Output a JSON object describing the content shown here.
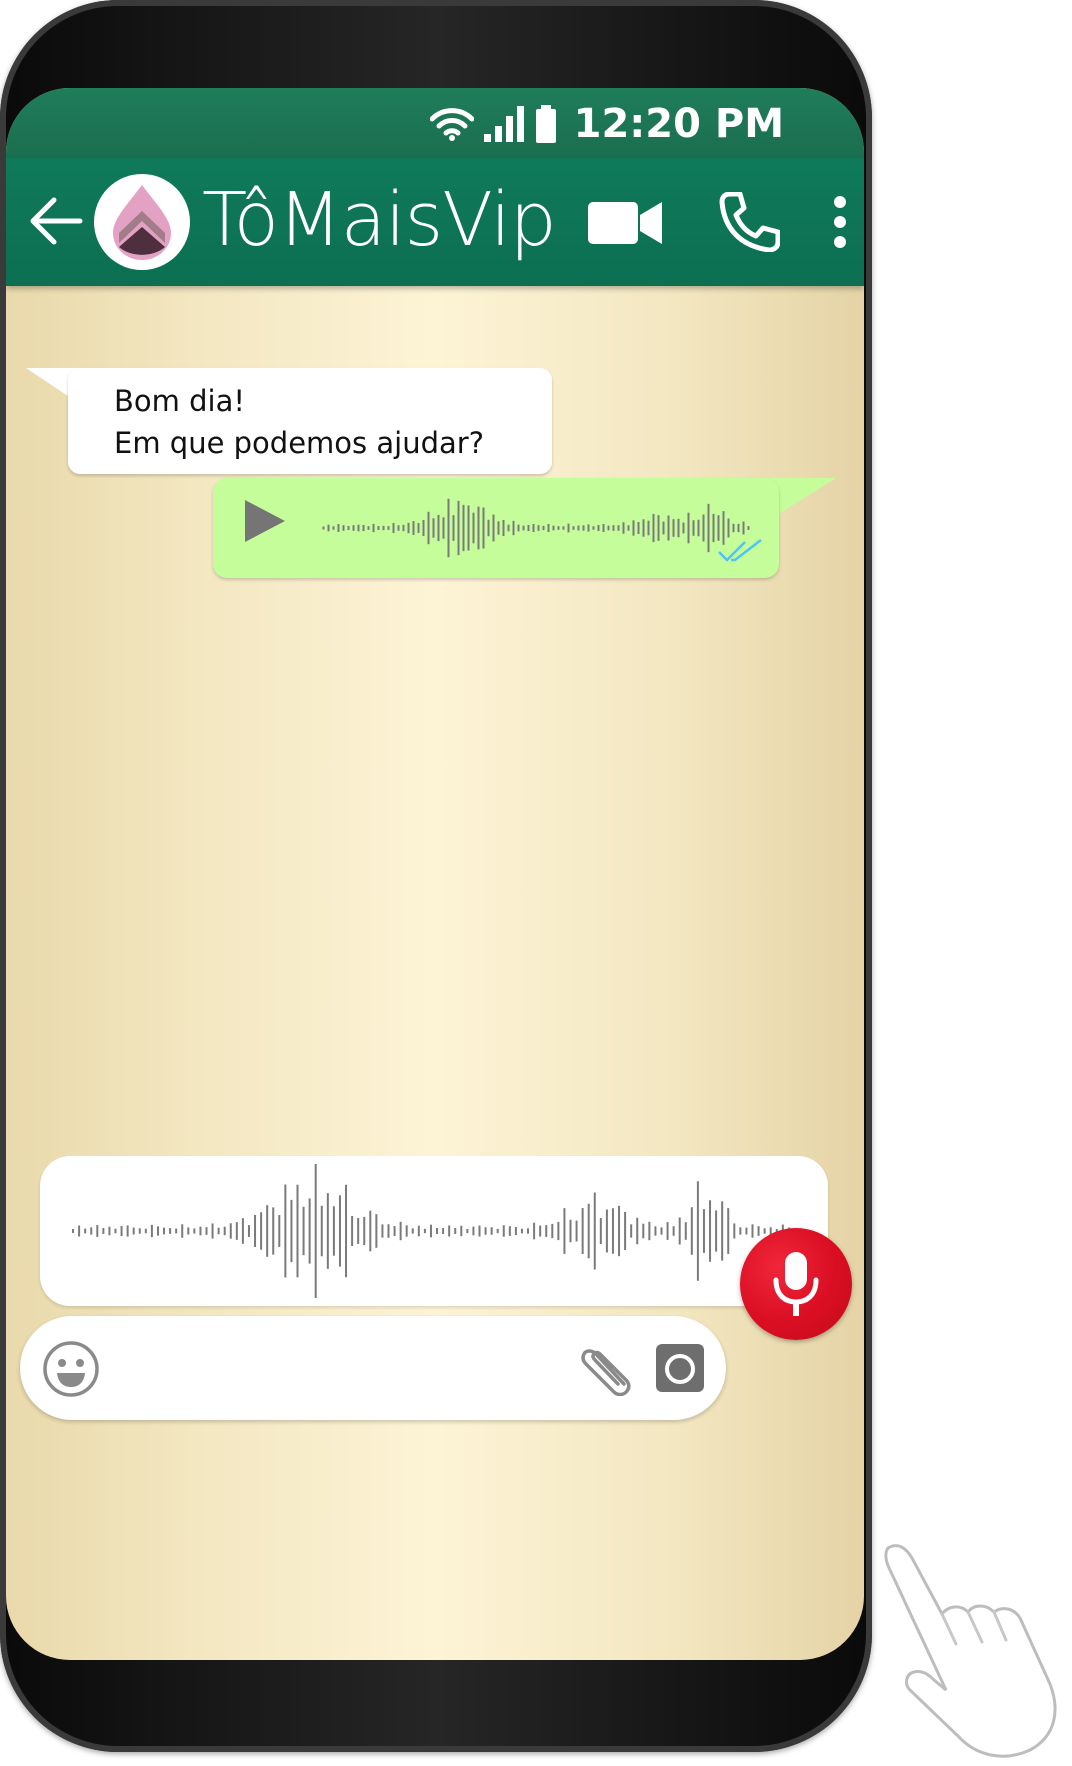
{
  "status_bar": {
    "time": "12:20 PM",
    "icons": [
      "wifi-icon",
      "signal-icon",
      "battery-icon"
    ]
  },
  "header": {
    "contact_name": "TôMaisVip",
    "icons": [
      "back-arrow-icon",
      "logo-avatar",
      "video-call-icon",
      "phone-call-icon",
      "more-vert-icon"
    ]
  },
  "messages": [
    {
      "direction": "incoming",
      "lines": [
        "Bom dia!",
        "Em que podemos ajudar?"
      ]
    },
    {
      "direction": "outgoing",
      "type": "voice",
      "status": "read"
    }
  ],
  "composer": {
    "input_value": "",
    "input_placeholder": "",
    "icons": [
      "emoji-icon",
      "attach-icon",
      "camera-icon",
      "mic-icon"
    ]
  },
  "overlay": {
    "icons": [
      "pointing-hand-icon"
    ]
  },
  "colors": {
    "header_green": "#0c6f51",
    "status_green": "#1a6e50",
    "outgoing_bubble": "#c6fd9b",
    "chat_bg": "#fdf4d6",
    "mic_red": "#da0e22",
    "read_tick": "#4fc3f7"
  }
}
